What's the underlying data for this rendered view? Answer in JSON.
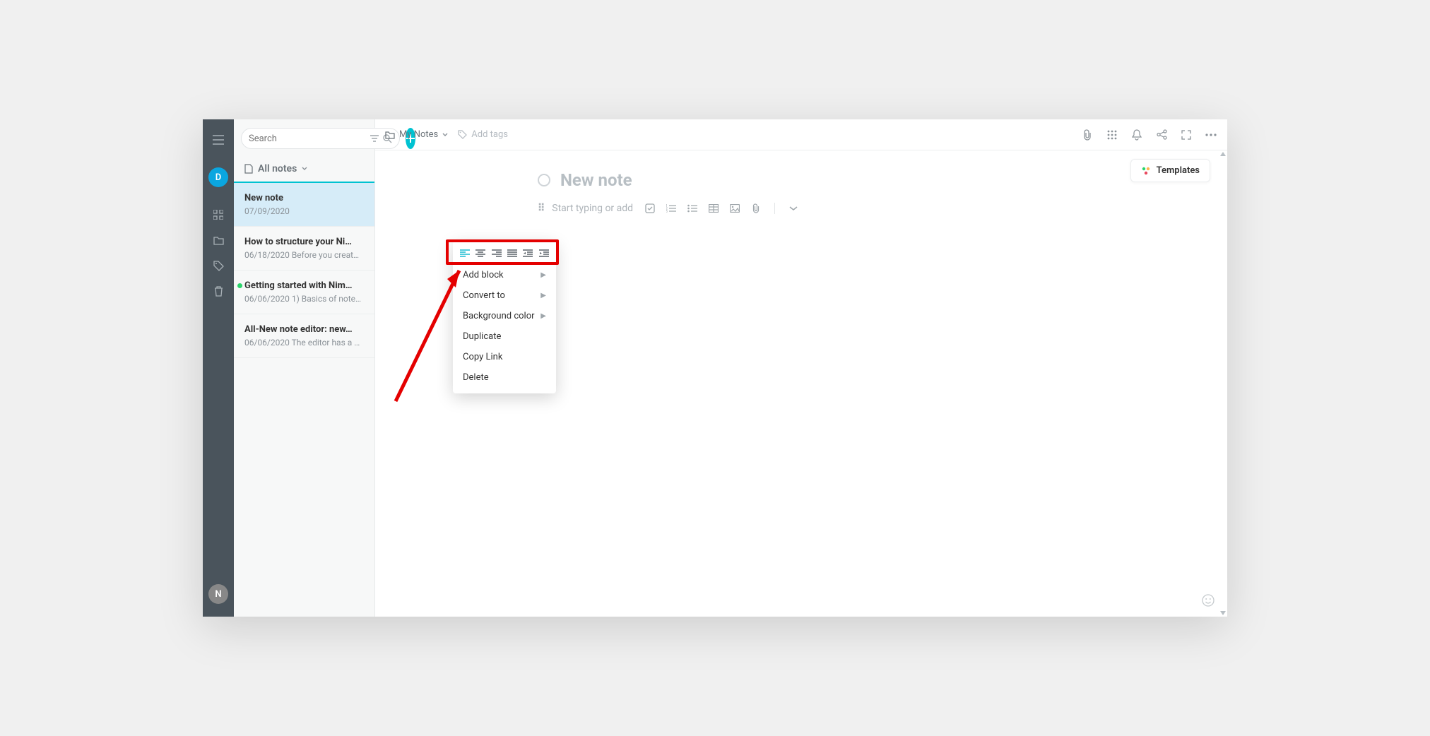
{
  "rail": {
    "avatar": "D",
    "bottom_avatar": "N"
  },
  "sidebar": {
    "search_placeholder": "Search",
    "header": "All notes",
    "notes": [
      {
        "title": "New note",
        "meta": "07/09/2020",
        "active": true,
        "dot": false
      },
      {
        "title": "How to structure your Ni…",
        "meta": "06/18/2020 Before you creat…",
        "active": false,
        "dot": false
      },
      {
        "title": "Getting started with Nim…",
        "meta": "06/06/2020 1) Basics of note…",
        "active": false,
        "dot": true
      },
      {
        "title": "All-New note editor: new…",
        "meta": "06/06/2020 The editor has a …",
        "active": false,
        "dot": false
      }
    ]
  },
  "topbar": {
    "folder": "My Notes",
    "tags_placeholder": "Add tags"
  },
  "editor": {
    "title": "New note",
    "placeholder": "Start typing or add",
    "templates_label": "Templates"
  },
  "context_menu": {
    "items": [
      {
        "label": "Add block",
        "submenu": true
      },
      {
        "label": "Convert to",
        "submenu": true
      },
      {
        "label": "Background color",
        "submenu": true
      },
      {
        "label": "Duplicate",
        "submenu": false
      },
      {
        "label": "Copy Link",
        "submenu": false
      },
      {
        "label": "Delete",
        "submenu": false
      }
    ]
  }
}
